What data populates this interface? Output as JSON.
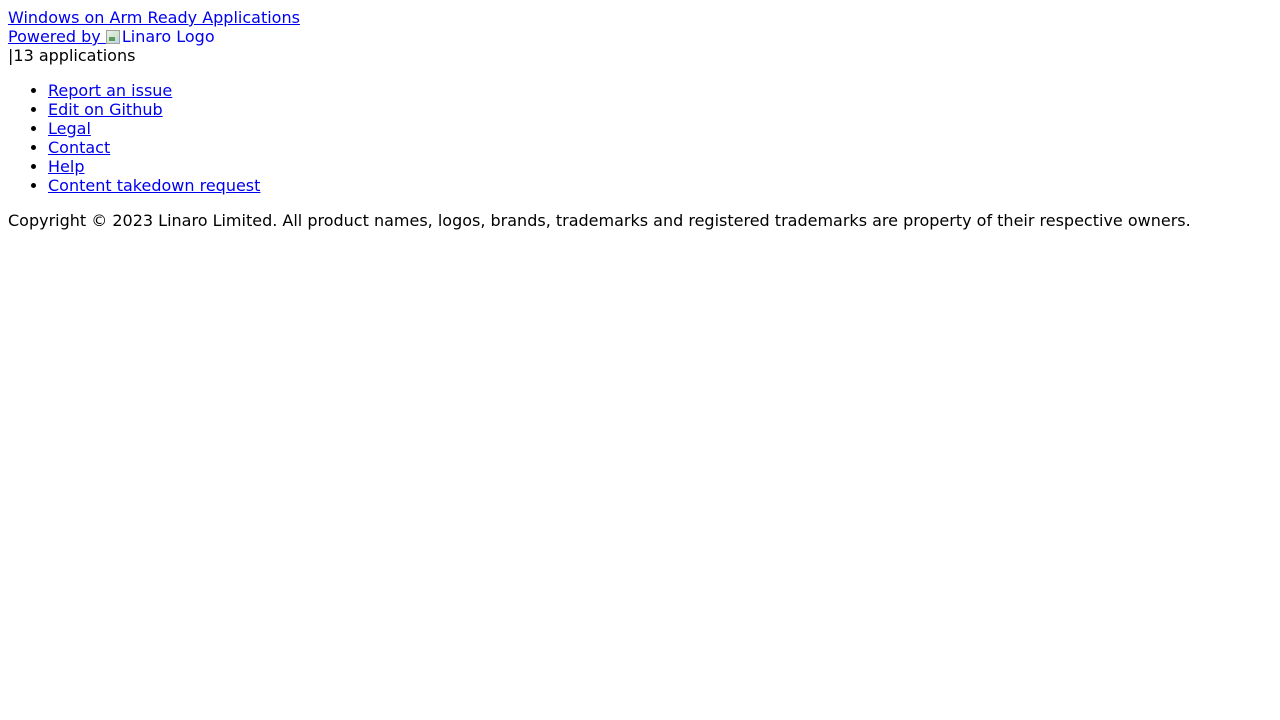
{
  "header": {
    "site_title": "Windows on Arm Ready Applications",
    "powered_by_prefix": "Powered by ",
    "logo_alt": "Linaro Logo",
    "app_count_text": "|13 applications"
  },
  "footer": {
    "links": [
      {
        "label": "Report an issue"
      },
      {
        "label": "Edit on Github"
      },
      {
        "label": "Legal"
      },
      {
        "label": "Contact"
      },
      {
        "label": "Help"
      },
      {
        "label": "Content takedown request"
      }
    ],
    "copyright": "Copyright © 2023 Linaro Limited. All product names, logos, brands, trademarks and registered trademarks are property of their respective owners."
  },
  "colors": {
    "link": "#0000ee",
    "text": "#000000",
    "background": "#ffffff"
  }
}
